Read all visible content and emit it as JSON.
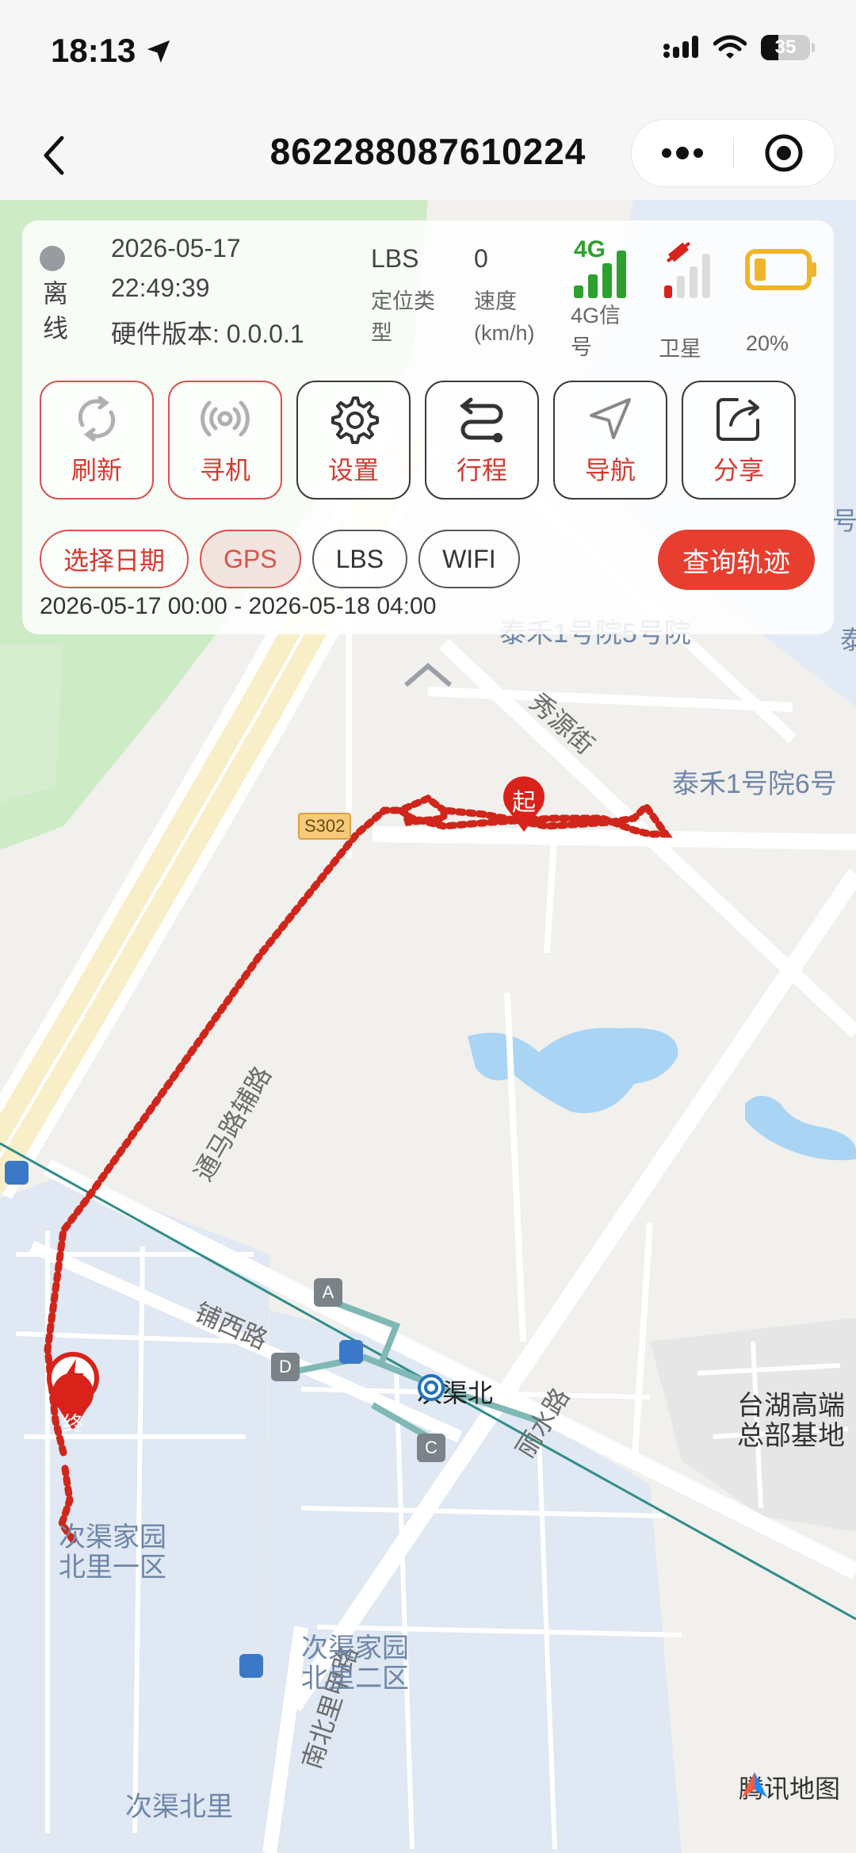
{
  "status_bar": {
    "time": "18:13",
    "battery_level": "35"
  },
  "nav": {
    "title": "862288087610224"
  },
  "device": {
    "status": "离线",
    "date": "2026-05-17",
    "time": "22:49:39",
    "hardware_version": "硬件版本: 0.0.0.1",
    "location_type_value": "LBS",
    "location_type_label": "定位类型",
    "speed_value": "0",
    "speed_label": "速度(km/h)",
    "signal_label": "4G信号",
    "satellite_label": "卫星",
    "battery_label": "20%",
    "signal_badge": "4G",
    "colors": {
      "offline": "#9a9ba0",
      "signal": "#2ea02e",
      "battery": "#f0b429",
      "accent": "#e83e2f"
    }
  },
  "actions": [
    {
      "label": "刷新",
      "icon": "refresh-icon"
    },
    {
      "label": "寻机",
      "icon": "ring-signal-icon"
    },
    {
      "label": "设置",
      "icon": "gear-icon"
    },
    {
      "label": "行程",
      "icon": "route-icon"
    },
    {
      "label": "导航",
      "icon": "navigate-icon"
    },
    {
      "label": "分享",
      "icon": "share-icon"
    }
  ],
  "filters": {
    "select_date": "选择日期",
    "gps": "GPS",
    "lbs": "LBS",
    "wifi": "WIFI",
    "query": "查询轨迹",
    "range": "2026-05-17 00:00 - 2026-05-18 04:00"
  },
  "map": {
    "labels": {
      "taihe5": "泰禾1号院5号院",
      "taihe6": "泰禾1号院6号",
      "xiuyuan": "秀源街",
      "s302": "S302",
      "tongma": "通马路辅路",
      "puxi": "铺西路",
      "lishui": "丽水路",
      "nanbei": "南北里甲路",
      "station": "次渠北",
      "taihu": "台湖高端\n总部基地",
      "ciqu1": "次渠家园\n北里一区",
      "ciqu2": "次渠家园\n北里二区",
      "ciqubei": "次渠北里",
      "exit_a": "A",
      "exit_c": "C",
      "exit_d": "D",
      "start": "起",
      "end": "终",
      "partial_hao": "号",
      "partial_tai": "泰"
    },
    "provider": "腾讯地图"
  }
}
